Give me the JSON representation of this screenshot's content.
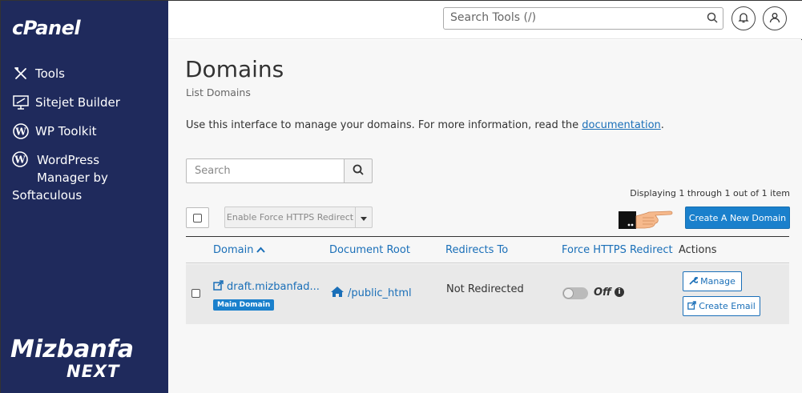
{
  "sidebar": {
    "logo": "cPanel",
    "items": [
      {
        "label": "Tools",
        "icon": "tools-icon"
      },
      {
        "label": "Sitejet Builder",
        "icon": "sitejet-icon"
      },
      {
        "label": "WP Toolkit",
        "icon": "wordpress-icon"
      }
    ],
    "wp_manager": {
      "line1": "WordPress",
      "line2": "Manager by",
      "line3": "Softaculous",
      "icon": "wordpress-icon"
    },
    "brand": {
      "line1": "Mizbanfa",
      "line2": "NEXT"
    }
  },
  "topbar": {
    "search_placeholder": "Search Tools (/)",
    "notifications_icon": "bell-icon",
    "user_icon": "user-icon"
  },
  "page": {
    "title": "Domains",
    "subtitle": "List Domains",
    "intro": "Use this interface to manage your domains. For more information, read the ",
    "intro_link": "documentation",
    "intro_end": "."
  },
  "toolbar": {
    "search_placeholder": "Search",
    "displaying": "Displaying 1 through 1 out of 1 item",
    "https_button": "Enable Force HTTPS Redirect",
    "create_button": "Create A New Domain"
  },
  "table": {
    "headers": {
      "domain": "Domain",
      "docroot": "Document Root",
      "redirects": "Redirects To",
      "https": "Force HTTPS Redirect",
      "actions": "Actions"
    },
    "rows": [
      {
        "domain": "draft.mizbanfad...",
        "badge": "Main Domain",
        "docroot": "/public_html",
        "redirects": "Not Redirected",
        "https_state": "Off",
        "manage": "Manage",
        "create_email": "Create Email"
      }
    ]
  },
  "colors": {
    "sidebar_bg": "#1f2a5c",
    "accent": "#1a80cc",
    "link": "#1a6fb8"
  }
}
